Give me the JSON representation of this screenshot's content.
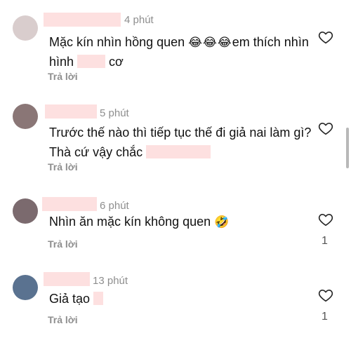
{
  "comments": [
    {
      "time": "4 phút",
      "text_a": "Mặc kín nhìn hồng quen ",
      "emojis": [
        "😂",
        "😂",
        "😂"
      ],
      "text_b": "em thích nhìn hình ",
      "text_c": " cơ",
      "reply": "Trả lời",
      "avatar_color": "#d9cdcd"
    },
    {
      "time": "5 phút",
      "text_a": "Trước thế nào thì tiếp tục thế đi giả nai làm gì? Thà cứ vậy chắc ",
      "reply": "Trả lời",
      "avatar_color": "#8a7676"
    },
    {
      "time": "6 phút",
      "text_a": "Nhìn ăn mặc kín không quen ",
      "emoji": "🤣",
      "reply": "Trả lời",
      "likes": "1",
      "avatar_color": "#7b6a6e"
    },
    {
      "time": "13 phút",
      "text_a": "Giả tạo ",
      "reply": "Trả lời",
      "likes": "1",
      "avatar_color": "#5a7290"
    }
  ],
  "icons": {
    "like": "heart-outline-icon"
  },
  "colors": {
    "redaction": "#fde0e0",
    "muted": "#8e8e8e"
  }
}
